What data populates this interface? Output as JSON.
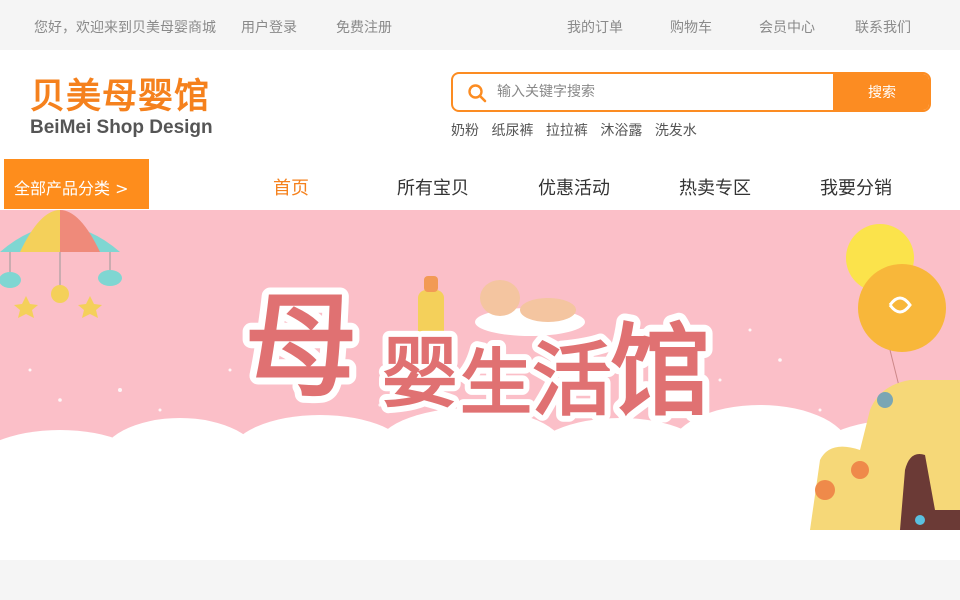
{
  "topbar": {
    "welcome": "您好，欢迎来到贝美母婴商城",
    "login": "用户登录",
    "register": "免费注册",
    "orders": "我的订单",
    "cart": "购物车",
    "member": "会员中心",
    "contact": "联系我们"
  },
  "logo": {
    "cn": "贝美母婴馆",
    "en": "BeiMei  Shop Design"
  },
  "search": {
    "placeholder": "输入关键字搜索",
    "button": "搜索",
    "hot_words": [
      "奶粉",
      "纸尿裤",
      "拉拉裤",
      "沐浴露",
      "洗发水"
    ]
  },
  "nav": {
    "category": "全部产品分类  >",
    "items": [
      "首页",
      "所有宝贝",
      "优惠活动",
      "热卖专区",
      "我要分销"
    ]
  },
  "banner": {
    "title_chars": [
      "母",
      "婴",
      "生",
      "活",
      "馆"
    ]
  },
  "colors": {
    "accent": "#fc8c22",
    "banner_bg": "#fbbfc8",
    "title_red": "#e07172"
  }
}
